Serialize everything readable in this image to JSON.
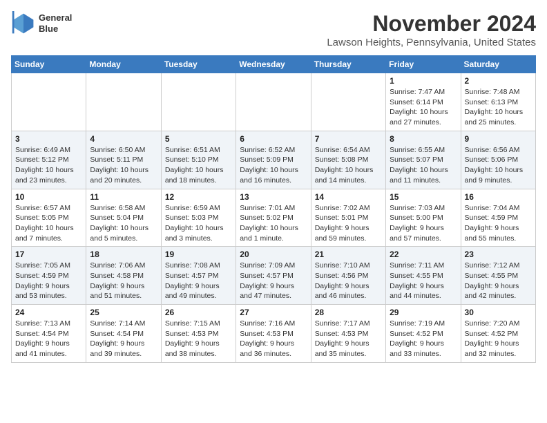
{
  "header": {
    "logo_line1": "General",
    "logo_line2": "Blue",
    "month": "November 2024",
    "location": "Lawson Heights, Pennsylvania, United States"
  },
  "weekdays": [
    "Sunday",
    "Monday",
    "Tuesday",
    "Wednesday",
    "Thursday",
    "Friday",
    "Saturday"
  ],
  "weeks": [
    [
      {
        "day": "",
        "info": ""
      },
      {
        "day": "",
        "info": ""
      },
      {
        "day": "",
        "info": ""
      },
      {
        "day": "",
        "info": ""
      },
      {
        "day": "",
        "info": ""
      },
      {
        "day": "1",
        "info": "Sunrise: 7:47 AM\nSunset: 6:14 PM\nDaylight: 10 hours\nand 27 minutes."
      },
      {
        "day": "2",
        "info": "Sunrise: 7:48 AM\nSunset: 6:13 PM\nDaylight: 10 hours\nand 25 minutes."
      }
    ],
    [
      {
        "day": "3",
        "info": "Sunrise: 6:49 AM\nSunset: 5:12 PM\nDaylight: 10 hours\nand 23 minutes."
      },
      {
        "day": "4",
        "info": "Sunrise: 6:50 AM\nSunset: 5:11 PM\nDaylight: 10 hours\nand 20 minutes."
      },
      {
        "day": "5",
        "info": "Sunrise: 6:51 AM\nSunset: 5:10 PM\nDaylight: 10 hours\nand 18 minutes."
      },
      {
        "day": "6",
        "info": "Sunrise: 6:52 AM\nSunset: 5:09 PM\nDaylight: 10 hours\nand 16 minutes."
      },
      {
        "day": "7",
        "info": "Sunrise: 6:54 AM\nSunset: 5:08 PM\nDaylight: 10 hours\nand 14 minutes."
      },
      {
        "day": "8",
        "info": "Sunrise: 6:55 AM\nSunset: 5:07 PM\nDaylight: 10 hours\nand 11 minutes."
      },
      {
        "day": "9",
        "info": "Sunrise: 6:56 AM\nSunset: 5:06 PM\nDaylight: 10 hours\nand 9 minutes."
      }
    ],
    [
      {
        "day": "10",
        "info": "Sunrise: 6:57 AM\nSunset: 5:05 PM\nDaylight: 10 hours\nand 7 minutes."
      },
      {
        "day": "11",
        "info": "Sunrise: 6:58 AM\nSunset: 5:04 PM\nDaylight: 10 hours\nand 5 minutes."
      },
      {
        "day": "12",
        "info": "Sunrise: 6:59 AM\nSunset: 5:03 PM\nDaylight: 10 hours\nand 3 minutes."
      },
      {
        "day": "13",
        "info": "Sunrise: 7:01 AM\nSunset: 5:02 PM\nDaylight: 10 hours\nand 1 minute."
      },
      {
        "day": "14",
        "info": "Sunrise: 7:02 AM\nSunset: 5:01 PM\nDaylight: 9 hours\nand 59 minutes."
      },
      {
        "day": "15",
        "info": "Sunrise: 7:03 AM\nSunset: 5:00 PM\nDaylight: 9 hours\nand 57 minutes."
      },
      {
        "day": "16",
        "info": "Sunrise: 7:04 AM\nSunset: 4:59 PM\nDaylight: 9 hours\nand 55 minutes."
      }
    ],
    [
      {
        "day": "17",
        "info": "Sunrise: 7:05 AM\nSunset: 4:59 PM\nDaylight: 9 hours\nand 53 minutes."
      },
      {
        "day": "18",
        "info": "Sunrise: 7:06 AM\nSunset: 4:58 PM\nDaylight: 9 hours\nand 51 minutes."
      },
      {
        "day": "19",
        "info": "Sunrise: 7:08 AM\nSunset: 4:57 PM\nDaylight: 9 hours\nand 49 minutes."
      },
      {
        "day": "20",
        "info": "Sunrise: 7:09 AM\nSunset: 4:57 PM\nDaylight: 9 hours\nand 47 minutes."
      },
      {
        "day": "21",
        "info": "Sunrise: 7:10 AM\nSunset: 4:56 PM\nDaylight: 9 hours\nand 46 minutes."
      },
      {
        "day": "22",
        "info": "Sunrise: 7:11 AM\nSunset: 4:55 PM\nDaylight: 9 hours\nand 44 minutes."
      },
      {
        "day": "23",
        "info": "Sunrise: 7:12 AM\nSunset: 4:55 PM\nDaylight: 9 hours\nand 42 minutes."
      }
    ],
    [
      {
        "day": "24",
        "info": "Sunrise: 7:13 AM\nSunset: 4:54 PM\nDaylight: 9 hours\nand 41 minutes."
      },
      {
        "day": "25",
        "info": "Sunrise: 7:14 AM\nSunset: 4:54 PM\nDaylight: 9 hours\nand 39 minutes."
      },
      {
        "day": "26",
        "info": "Sunrise: 7:15 AM\nSunset: 4:53 PM\nDaylight: 9 hours\nand 38 minutes."
      },
      {
        "day": "27",
        "info": "Sunrise: 7:16 AM\nSunset: 4:53 PM\nDaylight: 9 hours\nand 36 minutes."
      },
      {
        "day": "28",
        "info": "Sunrise: 7:17 AM\nSunset: 4:53 PM\nDaylight: 9 hours\nand 35 minutes."
      },
      {
        "day": "29",
        "info": "Sunrise: 7:19 AM\nSunset: 4:52 PM\nDaylight: 9 hours\nand 33 minutes."
      },
      {
        "day": "30",
        "info": "Sunrise: 7:20 AM\nSunset: 4:52 PM\nDaylight: 9 hours\nand 32 minutes."
      }
    ]
  ]
}
